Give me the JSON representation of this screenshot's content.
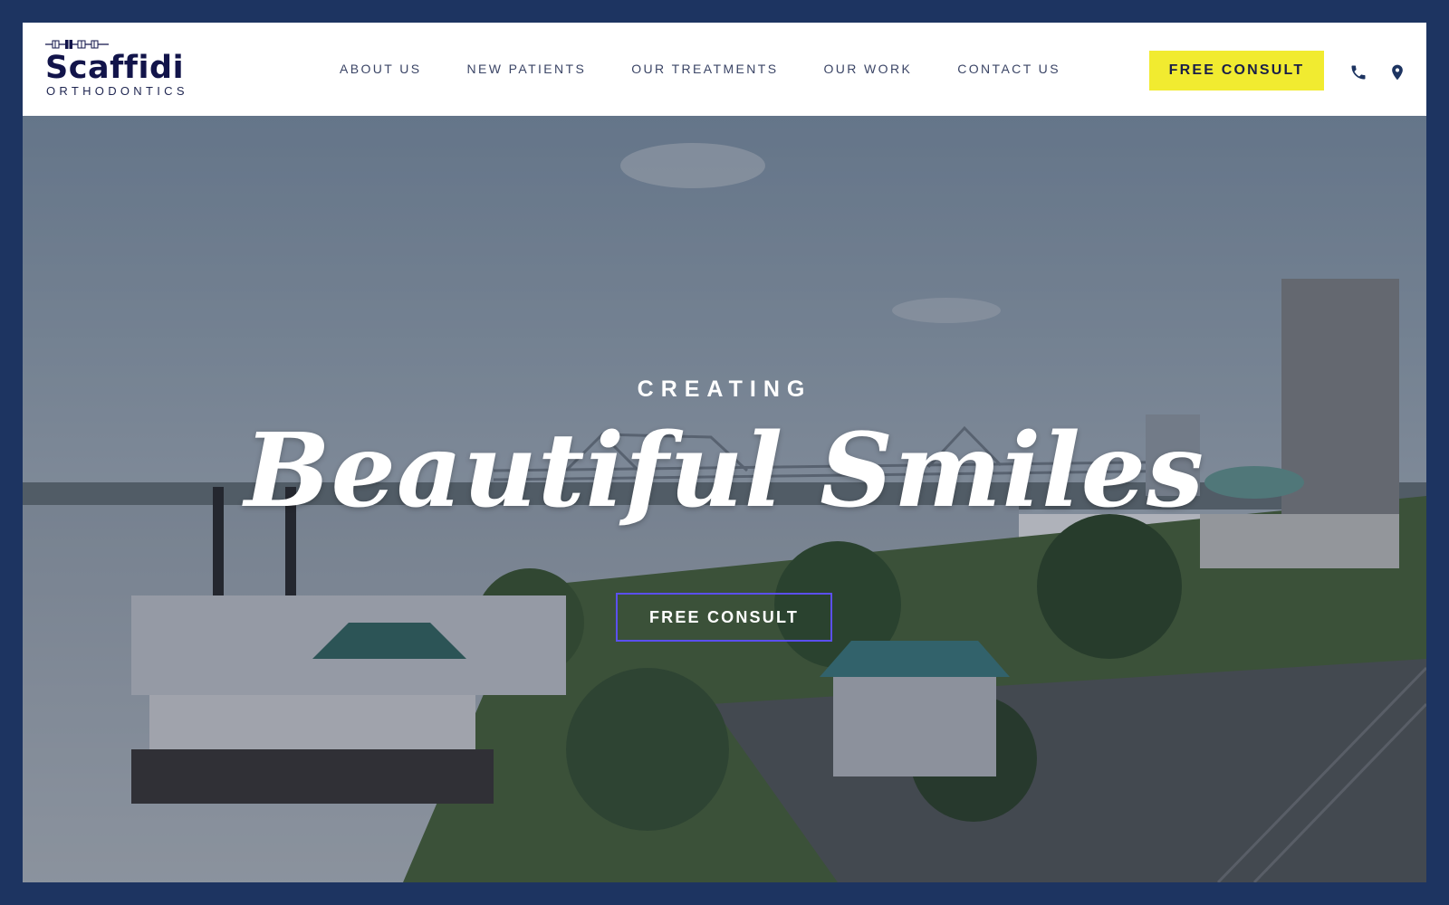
{
  "brand": {
    "name": "Scaffidi",
    "tagline": "ORTHODONTICS",
    "colors": {
      "navy": "#1d3461",
      "logo_text": "#12144a",
      "accent_yellow": "#f1eb30",
      "outline_button": "#5b4ff0"
    }
  },
  "nav": {
    "items": [
      {
        "label": "ABOUT US"
      },
      {
        "label": "NEW PATIENTS"
      },
      {
        "label": "OUR TREATMENTS"
      },
      {
        "label": "OUR WORK"
      },
      {
        "label": "CONTACT US"
      }
    ]
  },
  "header": {
    "cta_label": "FREE CONSULT",
    "icons": [
      "phone-icon",
      "map-pin-icon"
    ]
  },
  "hero": {
    "eyebrow": "CREATING",
    "title": "Beautiful Smiles",
    "button_label": "FREE CONSULT",
    "background": "aerial view of riverfront with paddle steamer, bridge and city skyline"
  }
}
